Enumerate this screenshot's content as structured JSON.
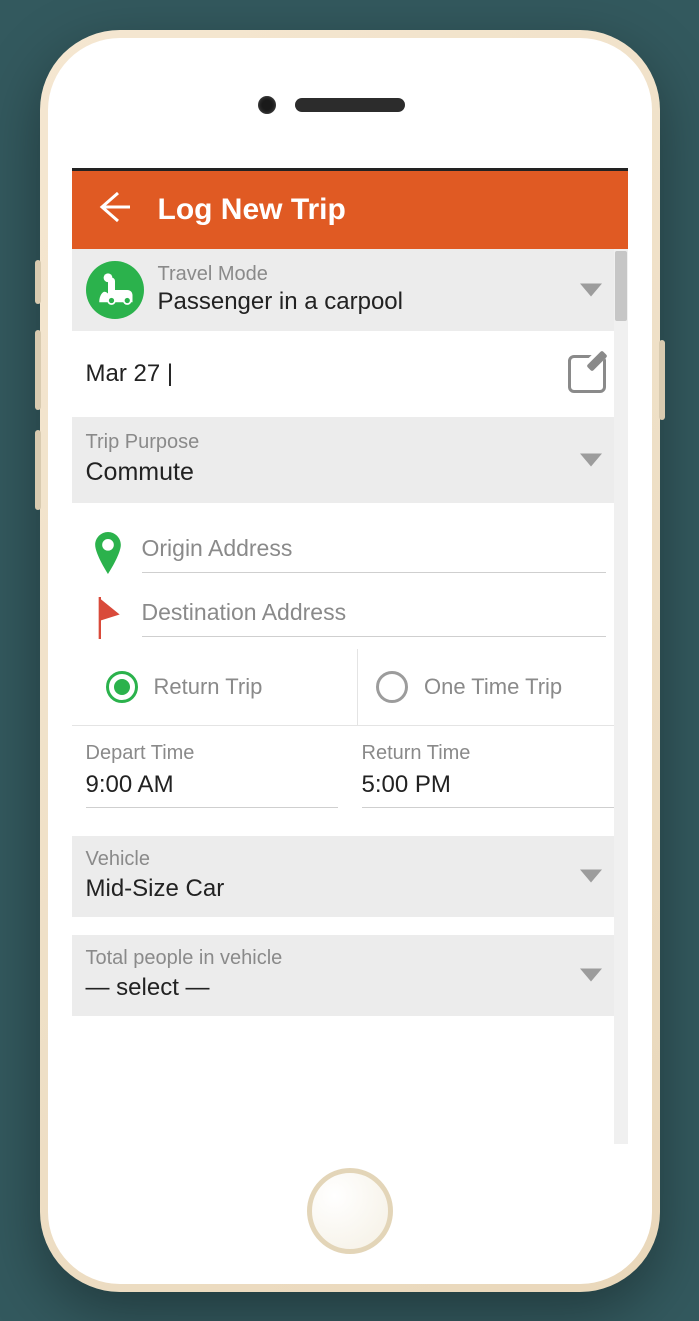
{
  "header": {
    "title": "Log New Trip"
  },
  "travel_mode": {
    "label": "Travel Mode",
    "value": "Passenger in a carpool"
  },
  "date": {
    "value": "Mar 27 |"
  },
  "purpose": {
    "label": "Trip Purpose",
    "value": "Commute"
  },
  "origin": {
    "placeholder": "Origin Address"
  },
  "destination": {
    "placeholder": "Destination Address"
  },
  "trip_type": {
    "return_label": "Return Trip",
    "onetime_label": "One Time Trip",
    "selected": "return"
  },
  "times": {
    "depart_label": "Depart Time",
    "depart_value": "9:00 AM",
    "return_label": "Return Time",
    "return_value": "5:00 PM"
  },
  "vehicle": {
    "label": "Vehicle",
    "value": "Mid-Size Car"
  },
  "people": {
    "label": "Total people in vehicle",
    "value": "— select —"
  }
}
